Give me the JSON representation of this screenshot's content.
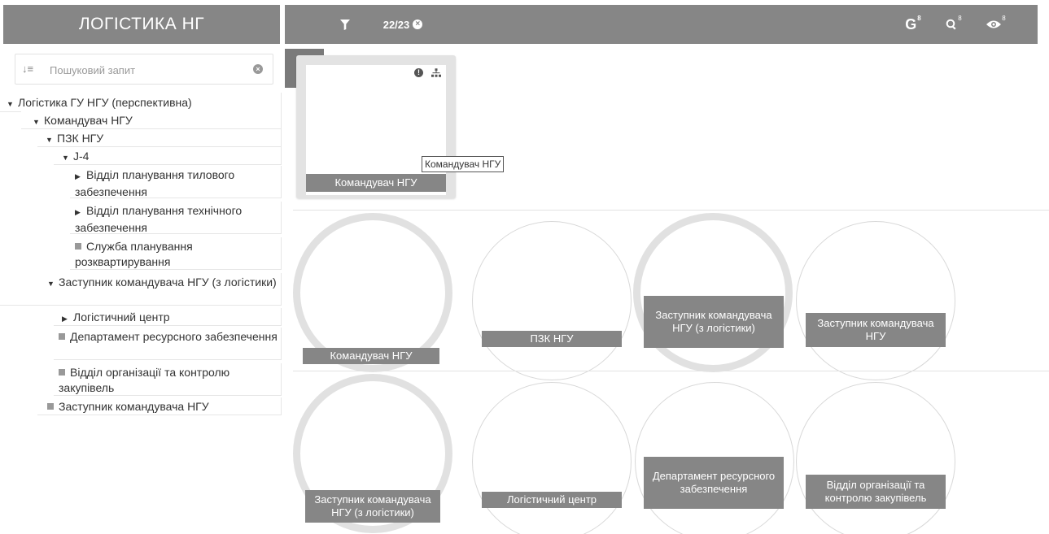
{
  "header": {
    "brand": "ЛОГІСТИКА НГ",
    "filter_count": "22/23",
    "g_label": "G",
    "badge": "8"
  },
  "sidebar": {
    "search": {
      "placeholder": "Пошуковий запит",
      "value": ""
    },
    "tree": [
      {
        "label": "Логістика ГУ НГУ (перспективна)",
        "state": "expanded"
      },
      {
        "label": "Командувач НГУ",
        "state": "expanded"
      },
      {
        "label": "ПЗК НГУ",
        "state": "expanded"
      },
      {
        "label": "J-4",
        "state": "expanded"
      },
      {
        "label": "Відділ планування тилового забезпечення",
        "state": "collapsed"
      },
      {
        "label": "Відділ планування технічного забезпечення",
        "state": "collapsed"
      },
      {
        "label": "Служба планування розквартирування",
        "state": "leaf"
      },
      {
        "label": "Заступник командувача НГУ (з логістики)",
        "state": "expanded"
      },
      {
        "label": "Логістичний центр",
        "state": "collapsed"
      },
      {
        "label": "Департамент ресурсного забезпечення",
        "state": "leaf"
      },
      {
        "label": "Відділ організації та контролю закупівель",
        "state": "leaf"
      },
      {
        "label": "Заступник командувача НГУ",
        "state": "leaf"
      }
    ]
  },
  "main": {
    "selected_card": {
      "label": "Командувач НГУ",
      "tooltip": "Командувач НГУ"
    },
    "row1": [
      {
        "label": "Командувач НГУ"
      },
      {
        "label": "ПЗК НГУ"
      },
      {
        "label": "Заступник командувача НГУ (з логістики)"
      },
      {
        "label": "Заступник командувача НГУ"
      }
    ],
    "row2": [
      {
        "label": "Заступник командувача НГУ (з логістики)"
      },
      {
        "label": "Логістичний центр"
      },
      {
        "label": "Департамент ресурсного забезпечення"
      },
      {
        "label": "Відділ організації та контролю закупівель"
      }
    ]
  },
  "colors": {
    "bar": "#868686",
    "active_button": "#7a7a7a",
    "label_bg": "#868686"
  }
}
